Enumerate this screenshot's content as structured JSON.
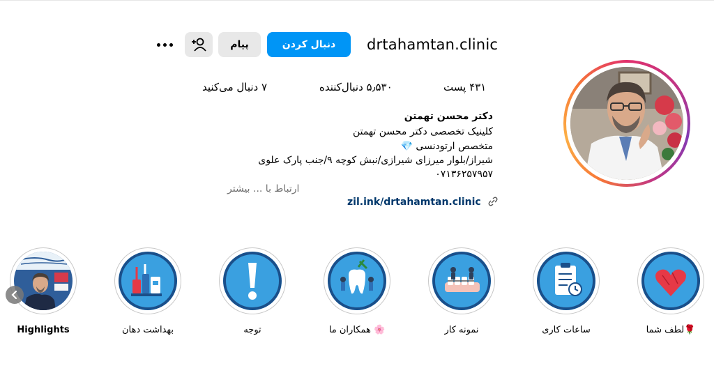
{
  "profile": {
    "username": "drtahamtan.clinic",
    "follow_label": "دنبال کردن",
    "message_label": "پیام",
    "add_label": "+",
    "more_icon": "more-horizontal-icon",
    "stats": {
      "posts": "۴۳۱ پست",
      "followers": "۵٫۵۳۰ دنبال‌کننده",
      "following": "۷ دنبال می‌کنید"
    },
    "display_name": "دکتر محسن تهمتن",
    "bio_lines": [
      "کلینیک تخصصی دکتر محسن تهمتن",
      "متخصص ارتودنسی 💎",
      "شیراز/بلوار میرزای شیرازی/نبش کوچه ۹/جنب پارک علوی",
      "۰۷۱۳۶۲۵۷۹۵۷"
    ],
    "more_text": "ارتباط با ... بیشتر",
    "link": "zil.ink/drtahamtan.clinic"
  },
  "highlights": [
    {
      "label": "لطف شما🌹",
      "icon": "heart-icon"
    },
    {
      "label": "ساعات کاری",
      "icon": "clipboard-clock-icon"
    },
    {
      "label": "نمونه کار",
      "icon": "braces-teeth-icon"
    },
    {
      "label": "همکاران ما 🌸",
      "icon": "team-tooth-icon"
    },
    {
      "label": "توجه",
      "icon": "exclamation-icon"
    },
    {
      "label": "بهداشت دهان",
      "icon": "dental-hygiene-icon"
    },
    {
      "label": "Highlights",
      "icon": "doctor-photo"
    }
  ],
  "colors": {
    "accent": "#0095f6",
    "secondary_button": "#e8e8e8",
    "link": "#00376b",
    "muted": "#737373"
  }
}
